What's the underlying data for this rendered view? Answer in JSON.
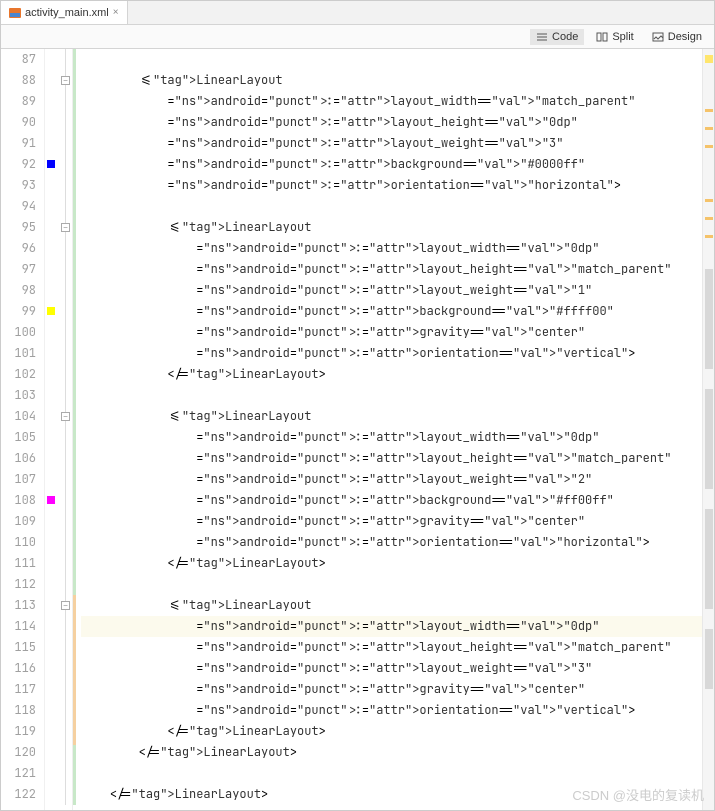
{
  "tab": {
    "filename": "activity_main.xml",
    "close": "×"
  },
  "views": {
    "code": "Code",
    "split": "Split",
    "design": "Design"
  },
  "lines": {
    "87": "",
    "88": "        <LinearLayout",
    "89": "            android:layout_width=\"match_parent\"",
    "90": "            android:layout_height=\"0dp\"",
    "91": "            android:layout_weight=\"3\"",
    "92": "            android:background=\"#0000ff\"",
    "93": "            android:orientation=\"horizontal\">",
    "94": "",
    "95": "            <LinearLayout",
    "96": "                android:layout_width=\"0dp\"",
    "97": "                android:layout_height=\"match_parent\"",
    "98": "                android:layout_weight=\"1\"",
    "99": "                android:background=\"#ffff00\"",
    "100": "                android:gravity=\"center\"",
    "101": "                android:orientation=\"vertical\">",
    "102": "            </LinearLayout>",
    "103": "",
    "104": "            <LinearLayout",
    "105": "                android:layout_width=\"0dp\"",
    "106": "                android:layout_height=\"match_parent\"",
    "107": "                android:layout_weight=\"2\"",
    "108": "                android:background=\"#ff00ff\"",
    "109": "                android:gravity=\"center\"",
    "110": "                android:orientation=\"horizontal\">",
    "111": "            </LinearLayout>",
    "112": "",
    "113": "            <LinearLayout",
    "114": "                android:layout_width=\"0dp\"",
    "115": "                android:layout_height=\"match_parent\"",
    "116": "                android:layout_weight=\"3\"",
    "117": "                android:gravity=\"center\"",
    "118": "                android:orientation=\"vertical\">",
    "119": "            </LinearLayout>",
    "120": "        </LinearLayout>",
    "121": "",
    "122": "    </LinearLayout>"
  },
  "watermark": "CSDN @没电的复读机"
}
